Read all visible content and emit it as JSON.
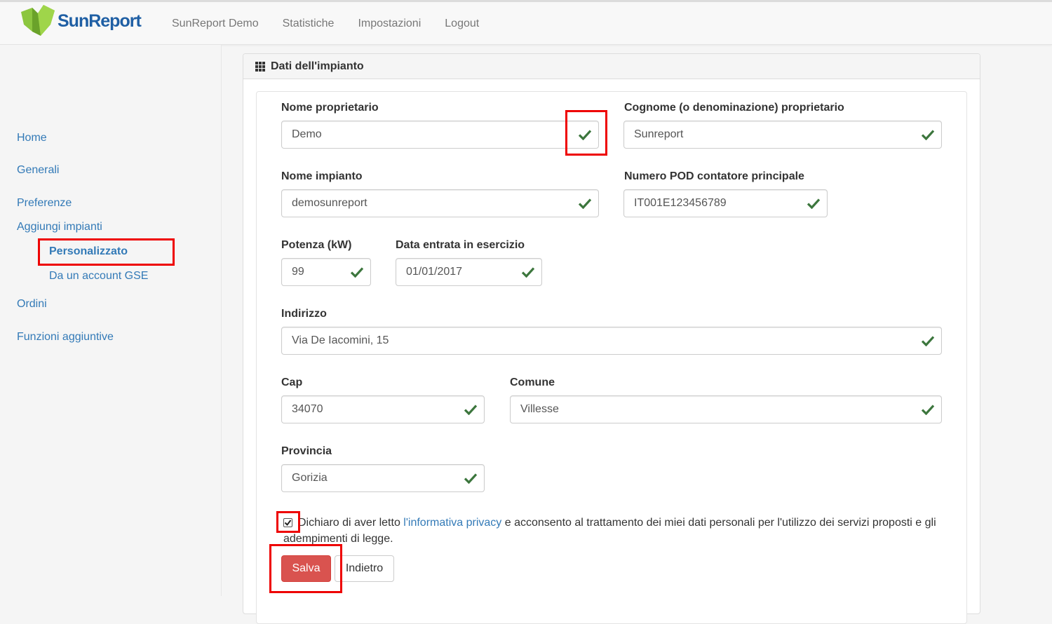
{
  "brand": {
    "name": "SunReport"
  },
  "nav": {
    "items": [
      {
        "label": "SunReport Demo"
      },
      {
        "label": "Statistiche"
      },
      {
        "label": "Impostazioni"
      },
      {
        "label": "Logout"
      }
    ]
  },
  "sidebar": {
    "home": "Home",
    "generali": "Generali",
    "preferenze": "Preferenze",
    "aggiungi_impianti": "Aggiungi impianti",
    "personalizzato": "Personalizzato",
    "da_account_gse": "Da un account GSE",
    "ordini": "Ordini",
    "funzioni_aggiuntive": "Funzioni aggiuntive"
  },
  "panel": {
    "title": "Dati dell'impianto",
    "title_icon": "grid-icon"
  },
  "form": {
    "nome_proprietario": {
      "label": "Nome proprietario",
      "value": "Demo"
    },
    "cognome_proprietario": {
      "label": "Cognome (o denominazione) proprietario",
      "value": "Sunreport"
    },
    "nome_impianto": {
      "label": "Nome impianto",
      "value": "demosunreport"
    },
    "numero_pod": {
      "label": "Numero POD contatore principale",
      "value": "IT001E123456789"
    },
    "potenza": {
      "label": "Potenza (kW)",
      "value": "99"
    },
    "data_entrata": {
      "label": "Data entrata in esercizio",
      "value": "01/01/2017"
    },
    "indirizzo": {
      "label": "Indirizzo",
      "value": "Via De Iacomini, 15"
    },
    "cap": {
      "label": "Cap",
      "value": "34070"
    },
    "comune": {
      "label": "Comune",
      "value": "Villesse"
    },
    "provincia": {
      "label": "Provincia",
      "value": "Gorizia"
    },
    "valid_icon": "check-icon",
    "valid_color": "#3c763d"
  },
  "consent": {
    "checked": true,
    "text_before": "Dichiaro di aver letto ",
    "link": "l'informativa privacy",
    "text_after": " e acconsento al trattamento dei miei dati personali per l'utilizzo dei servizi proposti e gli adempimenti di legge."
  },
  "actions": {
    "save_label": "Salva",
    "back_label": "Indietro"
  },
  "colors": {
    "link": "#337ab7",
    "danger": "#d9534f",
    "highlight": "#ee0000",
    "brand_green": "#8cc63f",
    "brand_blue": "#1f5fa4"
  }
}
